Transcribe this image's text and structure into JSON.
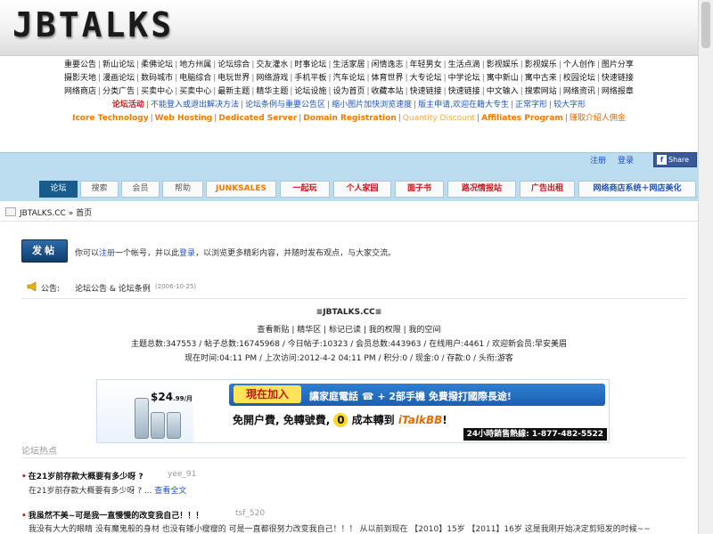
{
  "header": {
    "logo_text": "JBTALKS"
  },
  "links": {
    "row1": [
      "重要公告",
      "新山论坛",
      "柔佛论坛",
      "地方州属",
      "论坛综合",
      "交友灌水",
      "时事论坛",
      "生活家居",
      "闲情逸志",
      "年轻男女",
      "生活点滴",
      "影视娱乐",
      "影视娱乐",
      "个人创作",
      "图片分享"
    ],
    "row2": [
      "摄影天地",
      "漫画论坛",
      "数码城市",
      "电脑综合",
      "电玩世界",
      "网络游戏",
      "手机平板",
      "汽车论坛",
      "体育世界",
      "大专论坛",
      "中学论坛",
      "寓中新山",
      "寓中古来",
      "校园论坛",
      "快速链接"
    ],
    "row3": [
      "网络商店",
      "分类广告",
      "买卖中心",
      "买卖中心",
      "最新主题",
      "精华主题",
      "论坛设施",
      "设为首页",
      "收藏本站",
      "快速链接",
      "快速链接",
      "中文输入",
      "搜索网站",
      "网络资讯",
      "网络报章"
    ],
    "row4": [
      {
        "text": "论坛活动",
        "style": "red"
      },
      {
        "text": "不能登入或退出解决方法",
        "style": "blue"
      },
      {
        "text": "论坛条例与重要公告区",
        "style": "blue"
      },
      {
        "text": "缩小图片加快浏览速度",
        "style": "blue"
      },
      {
        "text": "版主申请,欢迎在籍大专生",
        "style": "blue"
      },
      {
        "text": "正常字形",
        "style": "blue"
      },
      {
        "text": "较大字形",
        "style": "blue"
      }
    ],
    "row5": [
      {
        "text": "Icore Technology",
        "style": "orange"
      },
      {
        "text": "Web Hosting",
        "style": "orange"
      },
      {
        "text": "Dedicated Server",
        "style": "orange"
      },
      {
        "text": "Domain Registration",
        "style": "orange"
      },
      {
        "text": "Quantity Discount",
        "style": "lorange"
      },
      {
        "text": "Affiliates Program",
        "style": "orange"
      },
      {
        "text": "赚取介绍人佣金",
        "style": "brown"
      }
    ]
  },
  "topnav": {
    "register": "注册",
    "login": "登录",
    "share": "Share"
  },
  "tabs": [
    "论坛",
    "搜索",
    "会员",
    "帮助",
    "JUNKSALES",
    "一起玩",
    "个人家园",
    "面子书",
    "路况情报站",
    "广告出租",
    "网络商店系统＋网店美化"
  ],
  "breadcrumb": {
    "site": "JBTALKS.CC",
    "sep": "»",
    "page": "首页"
  },
  "post": {
    "button": "发帖",
    "notice_pre": "你可以",
    "notice_register": "注册",
    "notice_mid": "一个帐号，并以此",
    "notice_login": "登录",
    "notice_post": "，以浏览更多精彩内容，并随时发布观点，与大家交流。"
  },
  "announcement": {
    "label": "公告:",
    "text": "论坛公告 & 论坛条例",
    "date": "(2006-10-25)"
  },
  "stats": {
    "title": "≡JBTALKS.CC≡",
    "quick_links": "查看新贴 | 精华区 | 标记已读 | 我的权限 | 我的空间",
    "line1": "主题总数:347553 / 帖子总数:16745968 / 今日帖子:10323 / 会员总数:443963 / 在线用户:4461 / 欢迎新会员:早安美眉",
    "line2": "现在时间:04:11 PM / 上次访问:2012-4-2 04:11 PM / 积分:0 / 现金:0 / 存款:0 / 头衔:游客"
  },
  "ad": {
    "price": "$24",
    "price_cents": ".99/月",
    "join": "現在加入",
    "strip_text": "讓家庭電話 ☎ + 2部手機 免費撥打國際長途!",
    "line2_a": "免開户費, 免轉號費,",
    "zero": "0",
    "line2_b": "成本轉到",
    "brand": "iTalkBB",
    "line2_c": "!",
    "hotline": "24小時銷售熱線: 1-877-482-5522"
  },
  "hot": {
    "title": "论坛热点",
    "items": [
      {
        "title": "在21岁前存款大概要有多少呀 ?",
        "author": "yee_91",
        "excerpt": "在21岁前存款大概要有多少呀 ? ...",
        "more": "查看全文"
      },
      {
        "title": "我虽然不美~可是我一直慢慢的改变我自己！！！",
        "author": "tsf_520",
        "excerpt": "我没有大大的眼睛 没有魔鬼般的身材 也没有矮小瘦瘦的 可是一直都很努力改变我自己！！！ 从以前到现在 【2010】15岁 【2011】16岁 这是我刚开始决定剪短发的时候~~"
      }
    ]
  },
  "colors": {
    "accent_blue": "#185c8e",
    "band": "#bcdcf0",
    "link_red": "#d0141b",
    "link_blue": "#1c53c0",
    "orange": "#f07b00"
  }
}
